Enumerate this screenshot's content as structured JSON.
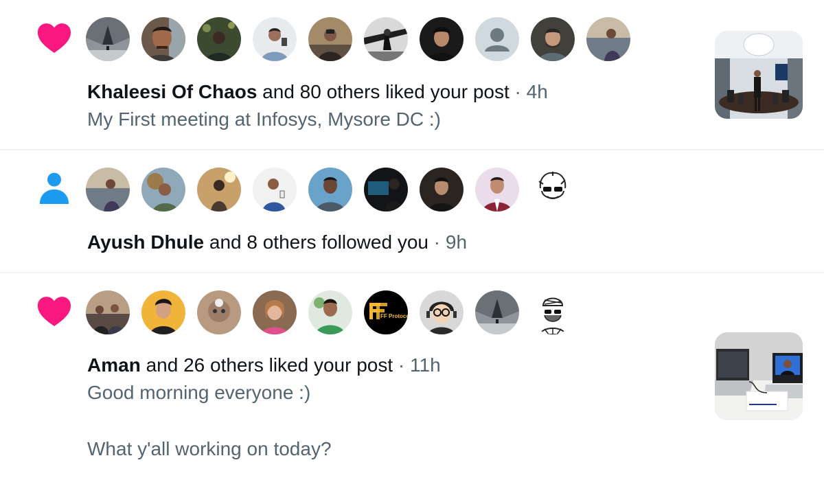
{
  "colors": {
    "like_pink": "#f91880",
    "follow_blue": "#1d9bf0",
    "text_primary": "#0f1419",
    "text_secondary": "#536471",
    "divider": "#eff3f4"
  },
  "notifications": [
    {
      "type": "like",
      "icon": "heart-icon",
      "avatars": [
        "avatar-1",
        "avatar-2",
        "avatar-3",
        "avatar-4",
        "avatar-5",
        "avatar-6",
        "avatar-7",
        "default-avatar",
        "avatar-9",
        "avatar-10"
      ],
      "actor": "Khaleesi Of Chaos",
      "action": " and 80 others liked your post",
      "time": " · 4h",
      "snippet": "My First meeting at Infosys, Mysore DC :)",
      "thumbnail": "meeting-room-photo"
    },
    {
      "type": "follow",
      "icon": "person-icon",
      "avatars": [
        "avatar-1",
        "avatar-2",
        "avatar-3",
        "avatar-4",
        "avatar-5",
        "avatar-6",
        "avatar-7",
        "avatar-8",
        "cartoon-avatar"
      ],
      "actor": "Ayush Dhule",
      "action": " and 8 others followed you",
      "time": " · 9h"
    },
    {
      "type": "like",
      "icon": "heart-icon",
      "avatars": [
        "avatar-1",
        "avatar-2",
        "avatar-3",
        "avatar-4",
        "avatar-5",
        "ff-protocol-logo",
        "avatar-7",
        "avatar-8",
        "cartoon-avatar"
      ],
      "avatar_logo_text": "FF Protoco",
      "actor": "Aman",
      "action": " and 26 others liked your post",
      "time": " · 11h",
      "snippet_line1": "Good morning everyone :)",
      "snippet_line2": "What y'all working on today?",
      "thumbnail": "laptop-desk-photo"
    }
  ]
}
